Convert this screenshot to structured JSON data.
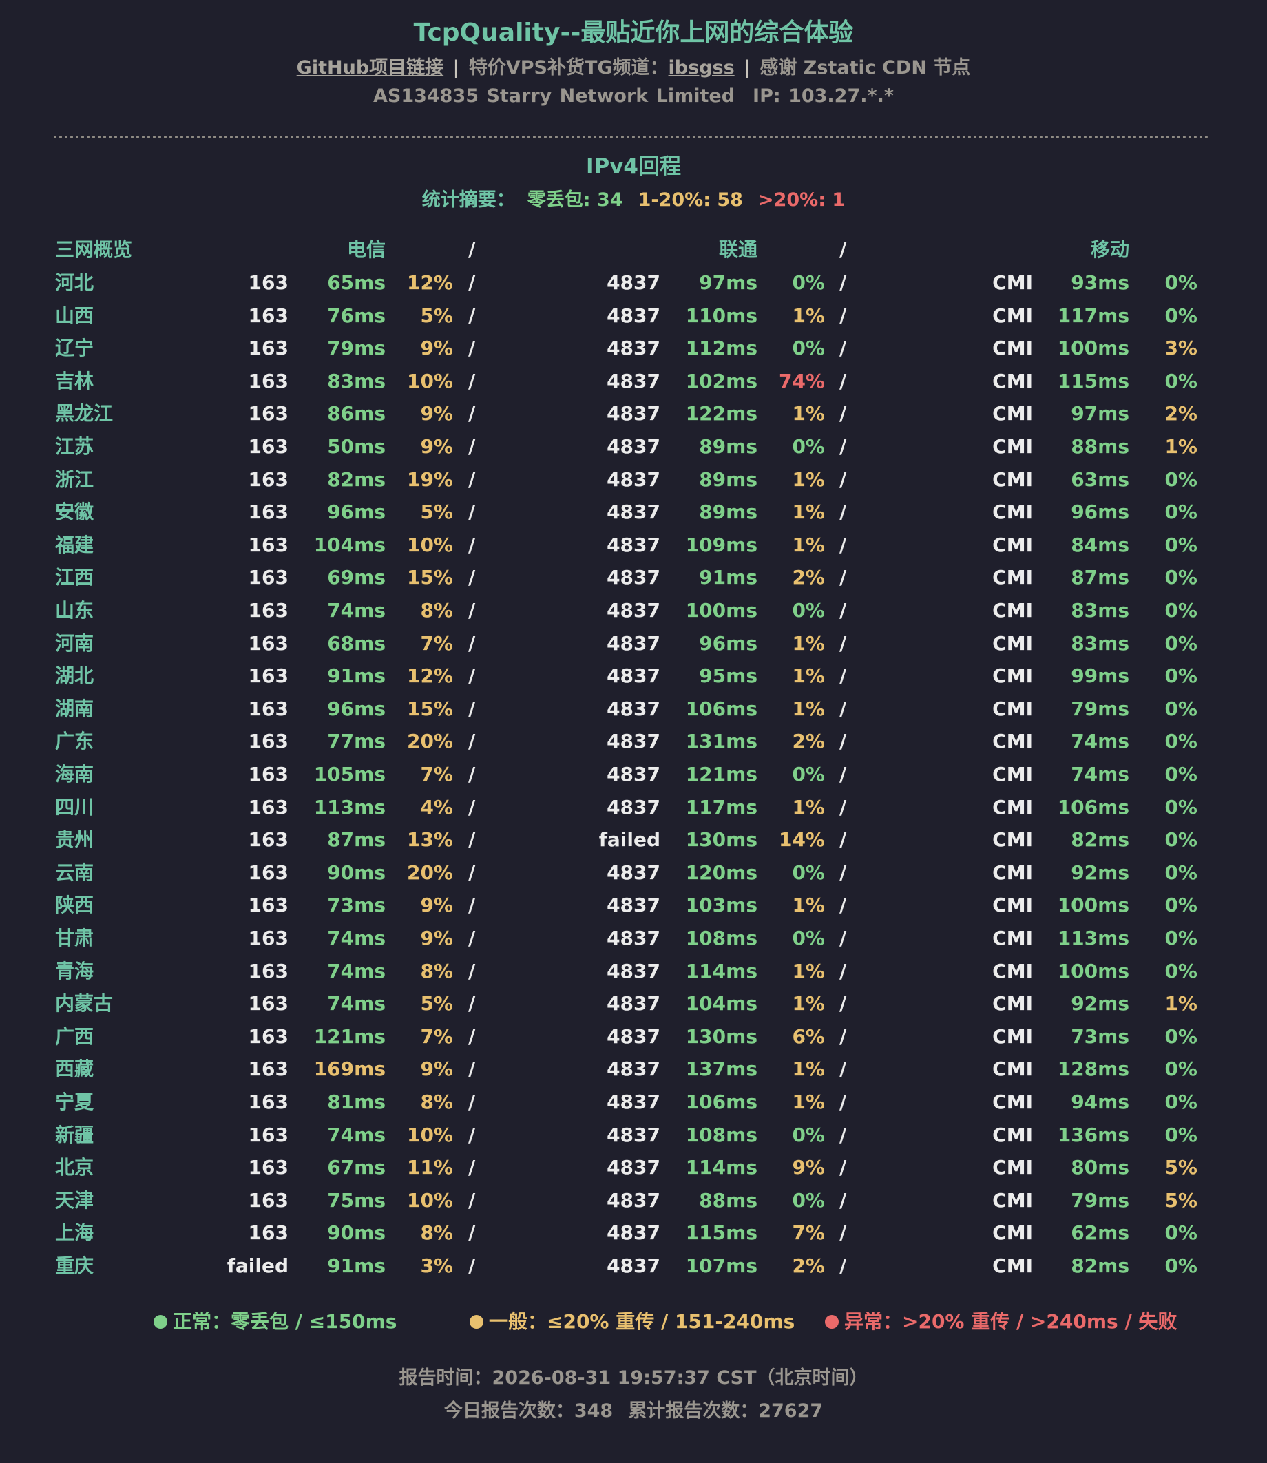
{
  "header": {
    "title": "TcpQuality--最贴近你上网的综合体验",
    "github_link": "GitHub项目链接",
    "separator": "|",
    "tg_prefix": "特价VPS补货TG频道：",
    "tg_link": "ibsgss",
    "cdn_text": "感谢 Zstatic CDN 节点",
    "asn": "AS134835 Starry Network Limited",
    "ip": "IP: 103.27.*.*"
  },
  "section": {
    "title": "IPv4回程",
    "summary_label": "统计摘要：",
    "summary_zero": "零丢包: 34",
    "summary_mid": "1-20%: 58",
    "summary_high": ">20%: 1"
  },
  "table": {
    "headers": {
      "overview": "三网概览",
      "telecom": "电信",
      "unicom": "联通",
      "mobile": "移动",
      "slash": "/"
    },
    "rows": [
      {
        "prov": "河北",
        "asn1": "163",
        "lat1": "65ms",
        "loss1": "12%",
        "asn2": "4837",
        "lat2": "97ms",
        "loss2": "0%",
        "asn3": "CMI",
        "lat3": "93ms",
        "loss3": "0%"
      },
      {
        "prov": "山西",
        "asn1": "163",
        "lat1": "76ms",
        "loss1": "5%",
        "asn2": "4837",
        "lat2": "110ms",
        "loss2": "1%",
        "asn3": "CMI",
        "lat3": "117ms",
        "loss3": "0%"
      },
      {
        "prov": "辽宁",
        "asn1": "163",
        "lat1": "79ms",
        "loss1": "9%",
        "asn2": "4837",
        "lat2": "112ms",
        "loss2": "0%",
        "asn3": "CMI",
        "lat3": "100ms",
        "loss3": "3%"
      },
      {
        "prov": "吉林",
        "asn1": "163",
        "lat1": "83ms",
        "loss1": "10%",
        "asn2": "4837",
        "lat2": "102ms",
        "loss2": "74%",
        "asn3": "CMI",
        "lat3": "115ms",
        "loss3": "0%"
      },
      {
        "prov": "黑龙江",
        "asn1": "163",
        "lat1": "86ms",
        "loss1": "9%",
        "asn2": "4837",
        "lat2": "122ms",
        "loss2": "1%",
        "asn3": "CMI",
        "lat3": "97ms",
        "loss3": "2%"
      },
      {
        "prov": "江苏",
        "asn1": "163",
        "lat1": "50ms",
        "loss1": "9%",
        "asn2": "4837",
        "lat2": "89ms",
        "loss2": "0%",
        "asn3": "CMI",
        "lat3": "88ms",
        "loss3": "1%"
      },
      {
        "prov": "浙江",
        "asn1": "163",
        "lat1": "82ms",
        "loss1": "19%",
        "asn2": "4837",
        "lat2": "89ms",
        "loss2": "1%",
        "asn3": "CMI",
        "lat3": "63ms",
        "loss3": "0%"
      },
      {
        "prov": "安徽",
        "asn1": "163",
        "lat1": "96ms",
        "loss1": "5%",
        "asn2": "4837",
        "lat2": "89ms",
        "loss2": "1%",
        "asn3": "CMI",
        "lat3": "96ms",
        "loss3": "0%"
      },
      {
        "prov": "福建",
        "asn1": "163",
        "lat1": "104ms",
        "loss1": "10%",
        "asn2": "4837",
        "lat2": "109ms",
        "loss2": "1%",
        "asn3": "CMI",
        "lat3": "84ms",
        "loss3": "0%"
      },
      {
        "prov": "江西",
        "asn1": "163",
        "lat1": "69ms",
        "loss1": "15%",
        "asn2": "4837",
        "lat2": "91ms",
        "loss2": "2%",
        "asn3": "CMI",
        "lat3": "87ms",
        "loss3": "0%"
      },
      {
        "prov": "山东",
        "asn1": "163",
        "lat1": "74ms",
        "loss1": "8%",
        "asn2": "4837",
        "lat2": "100ms",
        "loss2": "0%",
        "asn3": "CMI",
        "lat3": "83ms",
        "loss3": "0%"
      },
      {
        "prov": "河南",
        "asn1": "163",
        "lat1": "68ms",
        "loss1": "7%",
        "asn2": "4837",
        "lat2": "96ms",
        "loss2": "1%",
        "asn3": "CMI",
        "lat3": "83ms",
        "loss3": "0%"
      },
      {
        "prov": "湖北",
        "asn1": "163",
        "lat1": "91ms",
        "loss1": "12%",
        "asn2": "4837",
        "lat2": "95ms",
        "loss2": "1%",
        "asn3": "CMI",
        "lat3": "99ms",
        "loss3": "0%"
      },
      {
        "prov": "湖南",
        "asn1": "163",
        "lat1": "96ms",
        "loss1": "15%",
        "asn2": "4837",
        "lat2": "106ms",
        "loss2": "1%",
        "asn3": "CMI",
        "lat3": "79ms",
        "loss3": "0%"
      },
      {
        "prov": "广东",
        "asn1": "163",
        "lat1": "77ms",
        "loss1": "20%",
        "asn2": "4837",
        "lat2": "131ms",
        "loss2": "2%",
        "asn3": "CMI",
        "lat3": "74ms",
        "loss3": "0%"
      },
      {
        "prov": "海南",
        "asn1": "163",
        "lat1": "105ms",
        "loss1": "7%",
        "asn2": "4837",
        "lat2": "121ms",
        "loss2": "0%",
        "asn3": "CMI",
        "lat3": "74ms",
        "loss3": "0%"
      },
      {
        "prov": "四川",
        "asn1": "163",
        "lat1": "113ms",
        "loss1": "4%",
        "asn2": "4837",
        "lat2": "117ms",
        "loss2": "1%",
        "asn3": "CMI",
        "lat3": "106ms",
        "loss3": "0%"
      },
      {
        "prov": "贵州",
        "asn1": "163",
        "lat1": "87ms",
        "loss1": "13%",
        "asn2": "failed",
        "lat2": "130ms",
        "loss2": "14%",
        "asn3": "CMI",
        "lat3": "82ms",
        "loss3": "0%"
      },
      {
        "prov": "云南",
        "asn1": "163",
        "lat1": "90ms",
        "loss1": "20%",
        "asn2": "4837",
        "lat2": "120ms",
        "loss2": "0%",
        "asn3": "CMI",
        "lat3": "92ms",
        "loss3": "0%"
      },
      {
        "prov": "陕西",
        "asn1": "163",
        "lat1": "73ms",
        "loss1": "9%",
        "asn2": "4837",
        "lat2": "103ms",
        "loss2": "1%",
        "asn3": "CMI",
        "lat3": "100ms",
        "loss3": "0%"
      },
      {
        "prov": "甘肃",
        "asn1": "163",
        "lat1": "74ms",
        "loss1": "9%",
        "asn2": "4837",
        "lat2": "108ms",
        "loss2": "0%",
        "asn3": "CMI",
        "lat3": "113ms",
        "loss3": "0%"
      },
      {
        "prov": "青海",
        "asn1": "163",
        "lat1": "74ms",
        "loss1": "8%",
        "asn2": "4837",
        "lat2": "114ms",
        "loss2": "1%",
        "asn3": "CMI",
        "lat3": "100ms",
        "loss3": "0%"
      },
      {
        "prov": "内蒙古",
        "asn1": "163",
        "lat1": "74ms",
        "loss1": "5%",
        "asn2": "4837",
        "lat2": "104ms",
        "loss2": "1%",
        "asn3": "CMI",
        "lat3": "92ms",
        "loss3": "1%"
      },
      {
        "prov": "广西",
        "asn1": "163",
        "lat1": "121ms",
        "loss1": "7%",
        "asn2": "4837",
        "lat2": "130ms",
        "loss2": "6%",
        "asn3": "CMI",
        "lat3": "73ms",
        "loss3": "0%"
      },
      {
        "prov": "西藏",
        "asn1": "163",
        "lat1": "169ms",
        "loss1": "9%",
        "asn2": "4837",
        "lat2": "137ms",
        "loss2": "1%",
        "asn3": "CMI",
        "lat3": "128ms",
        "loss3": "0%"
      },
      {
        "prov": "宁夏",
        "asn1": "163",
        "lat1": "81ms",
        "loss1": "8%",
        "asn2": "4837",
        "lat2": "106ms",
        "loss2": "1%",
        "asn3": "CMI",
        "lat3": "94ms",
        "loss3": "0%"
      },
      {
        "prov": "新疆",
        "asn1": "163",
        "lat1": "74ms",
        "loss1": "10%",
        "asn2": "4837",
        "lat2": "108ms",
        "loss2": "0%",
        "asn3": "CMI",
        "lat3": "136ms",
        "loss3": "0%"
      },
      {
        "prov": "北京",
        "asn1": "163",
        "lat1": "67ms",
        "loss1": "11%",
        "asn2": "4837",
        "lat2": "114ms",
        "loss2": "9%",
        "asn3": "CMI",
        "lat3": "80ms",
        "loss3": "5%"
      },
      {
        "prov": "天津",
        "asn1": "163",
        "lat1": "75ms",
        "loss1": "10%",
        "asn2": "4837",
        "lat2": "88ms",
        "loss2": "0%",
        "asn3": "CMI",
        "lat3": "79ms",
        "loss3": "5%"
      },
      {
        "prov": "上海",
        "asn1": "163",
        "lat1": "90ms",
        "loss1": "8%",
        "asn2": "4837",
        "lat2": "115ms",
        "loss2": "7%",
        "asn3": "CMI",
        "lat3": "62ms",
        "loss3": "0%"
      },
      {
        "prov": "重庆",
        "asn1": "failed",
        "lat1": "91ms",
        "loss1": "3%",
        "asn2": "4837",
        "lat2": "107ms",
        "loss2": "2%",
        "asn3": "CMI",
        "lat3": "82ms",
        "loss3": "0%"
      }
    ]
  },
  "legend": {
    "good": "正常：零丢包 / ≤150ms",
    "warn": "一般：≤20% 重传 / 151-240ms",
    "bad": "异常：>20% 重传 / >240ms / 失败"
  },
  "colors": {
    "good": "#7fd08a",
    "warn": "#e8c06f",
    "bad": "#ea6a6a",
    "accent": "#6fc4a6",
    "background": "#1f1f2c"
  },
  "footer": {
    "report_time": "报告时间：2026-08-31 19:57:37 CST（北京时间）",
    "today_count": "今日报告次数：348",
    "total_count": "累计报告次数：27627"
  }
}
